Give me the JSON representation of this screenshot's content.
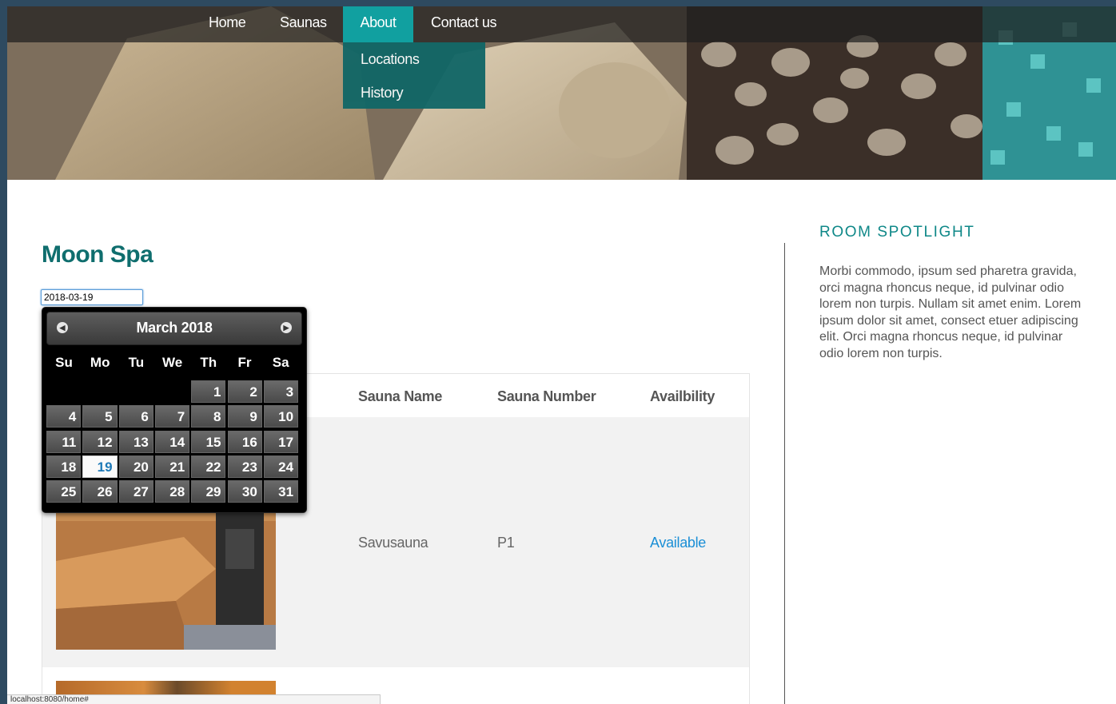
{
  "nav": {
    "items": [
      "Home",
      "Saunas",
      "About",
      "Contact us"
    ],
    "active": "About",
    "dropdown": [
      "Locations",
      "History"
    ]
  },
  "main": {
    "title": "Moon Spa",
    "date_value": "2018-03-19"
  },
  "datepicker": {
    "title": "March 2018",
    "prev_icon": "circle-triangle-left-icon",
    "next_icon": "circle-triangle-right-icon",
    "weekdays": [
      "Su",
      "Mo",
      "Tu",
      "We",
      "Th",
      "Fr",
      "Sa"
    ],
    "first_weekday_index": 4,
    "days_in_month": 31,
    "selected_day": "19"
  },
  "table": {
    "headers": {
      "name": "Sauna Name",
      "number": "Sauna Number",
      "availability": "Availbility"
    },
    "rows": [
      {
        "name": "Savusauna",
        "number": "P1",
        "availability": "Available"
      }
    ]
  },
  "sidebar": {
    "title": "ROOM SPOTLIGHT",
    "text": "Morbi commodo, ipsum sed pharetra gravida, orci magna rhoncus neque, id pulvinar odio lorem non turpis. Nullam sit amet enim. Lorem ipsum dolor sit amet, consect etuer adipiscing elit. Orci magna rhoncus neque, id pulvinar odio lorem non turpis."
  },
  "status_bar": {
    "url": "localhost:8080/home#"
  },
  "colors": {
    "accent": "#11a0a0",
    "dropdown_bg": "#106666",
    "title": "#0f6e6e",
    "link": "#1b8fd6"
  }
}
